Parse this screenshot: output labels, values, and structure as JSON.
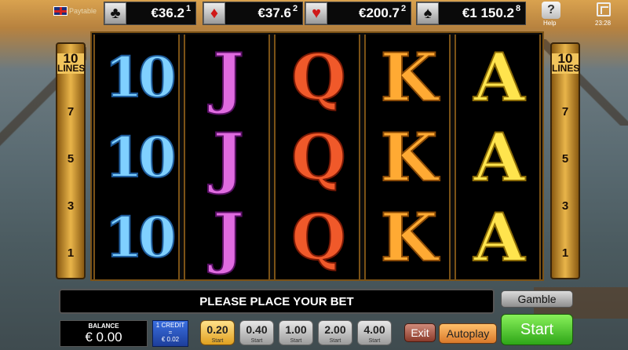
{
  "topbar": {
    "paytable_label": "Paytable",
    "jackpots": [
      {
        "suit": "club-icon",
        "glyph": "♣",
        "amount": "€36.2",
        "level": "1"
      },
      {
        "suit": "diamond-icon",
        "glyph": "♦",
        "amount": "€37.6",
        "level": "2"
      },
      {
        "suit": "heart-icon",
        "glyph": "♥",
        "amount": "€200.7",
        "level": "2"
      },
      {
        "suit": "spade-icon",
        "glyph": "♠",
        "amount": "€1 150.2",
        "level": "8"
      }
    ],
    "help_glyph": "?",
    "help_label": "Help",
    "time": "23:28"
  },
  "paylines": {
    "count": "10",
    "lines_label": "LINES",
    "numbers": [
      "7",
      "5",
      "3",
      "1"
    ]
  },
  "reels": [
    {
      "symbol": "10",
      "rows": [
        "10",
        "10",
        "10"
      ]
    },
    {
      "symbol": "J",
      "rows": [
        "J",
        "J",
        "J"
      ]
    },
    {
      "symbol": "Q",
      "rows": [
        "Q",
        "Q",
        "Q"
      ]
    },
    {
      "symbol": "K",
      "rows": [
        "K",
        "K",
        "K"
      ]
    },
    {
      "symbol": "A",
      "rows": [
        "A",
        "A",
        "A"
      ]
    }
  ],
  "message": "PLEASE PLACE YOUR BET",
  "controls": {
    "gamble": "Gamble",
    "balance_label": "BALANCE",
    "balance_value": "€ 0.00",
    "credit_line1": "1 CREDIT",
    "credit_line2": "=",
    "credit_line3": "€ 0.02",
    "bets": [
      "0.20",
      "0.40",
      "1.00",
      "2.00",
      "4.00"
    ],
    "bet_sub": "Start",
    "exit": "Exit",
    "autoplay": "Autoplay",
    "start": "Start"
  },
  "colors": {
    "gold": "#e9b54a",
    "start_green": "#2ea618",
    "autoplay_orange": "#d9792a"
  }
}
